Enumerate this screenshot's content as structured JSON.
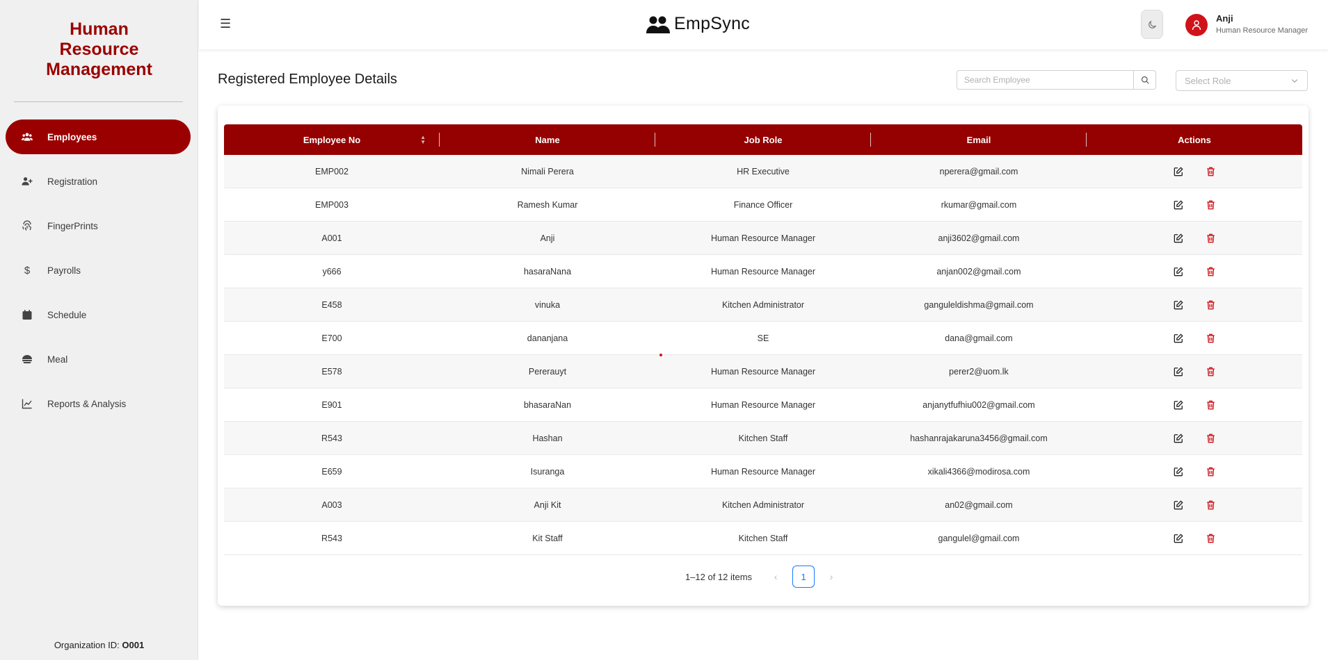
{
  "sidebar": {
    "brand": "Human Resource Management",
    "items": [
      {
        "label": "Employees",
        "icon": "users-icon",
        "active": true
      },
      {
        "label": "Registration",
        "icon": "user-plus-icon"
      },
      {
        "label": "FingerPrints",
        "icon": "fingerprint-icon"
      },
      {
        "label": "Payrolls",
        "icon": "dollar-icon"
      },
      {
        "label": "Schedule",
        "icon": "calendar-icon"
      },
      {
        "label": "Meal",
        "icon": "meal-icon"
      },
      {
        "label": "Reports & Analysis",
        "icon": "chart-line-icon"
      }
    ],
    "org_label": "Organization ID:",
    "org_id": "O001"
  },
  "header": {
    "app_name": "EmpSync",
    "user": {
      "name": "Anji",
      "role": "Human Resource Manager"
    }
  },
  "main": {
    "title": "Registered Employee Details",
    "search_placeholder": "Search Employee",
    "role_placeholder": "Select Role"
  },
  "table": {
    "columns": [
      "Employee No",
      "Name",
      "Job Role",
      "Email",
      "Actions"
    ],
    "rows": [
      [
        "EMP002",
        "Nimali Perera",
        "HR Executive",
        "nperera@gmail.com"
      ],
      [
        "EMP003",
        "Ramesh Kumar",
        "Finance Officer",
        "rkumar@gmail.com"
      ],
      [
        "A001",
        "Anji",
        "Human Resource Manager",
        "anji3602@gmail.com"
      ],
      [
        "y666",
        "hasaraNana",
        "Human Resource Manager",
        "anjan002@gmail.com"
      ],
      [
        "E458",
        "vinuka",
        "Kitchen Administrator",
        "ganguleldishma@gmail.com"
      ],
      [
        "E700",
        "dananjana",
        "SE",
        "dana@gmail.com"
      ],
      [
        "E578",
        "Pererauyt",
        "Human Resource Manager",
        "perer2@uom.lk"
      ],
      [
        "E901",
        "bhasaraNan",
        "Human Resource Manager",
        "anjanytfufhiu002@gmail.com"
      ],
      [
        "R543",
        "Hashan",
        "Kitchen Staff",
        "hashanrajakaruna3456@gmail.com"
      ],
      [
        "E659",
        "Isuranga",
        "Human Resource Manager",
        "xikali4366@modirosa.com"
      ],
      [
        "A003",
        "Anji Kit",
        "Kitchen Administrator",
        "an02@gmail.com"
      ],
      [
        "R543",
        "Kit Staff",
        "Kitchen Staff",
        "gangulel@gmail.com"
      ]
    ]
  },
  "pagination": {
    "range_text": "1–12 of 12 items",
    "current_page": "1",
    "prev": "‹",
    "next": "›"
  },
  "colors": {
    "brand": "#9b0000",
    "table_header": "#950000",
    "delete": "#d0121a",
    "page_active": "#1677ff"
  }
}
